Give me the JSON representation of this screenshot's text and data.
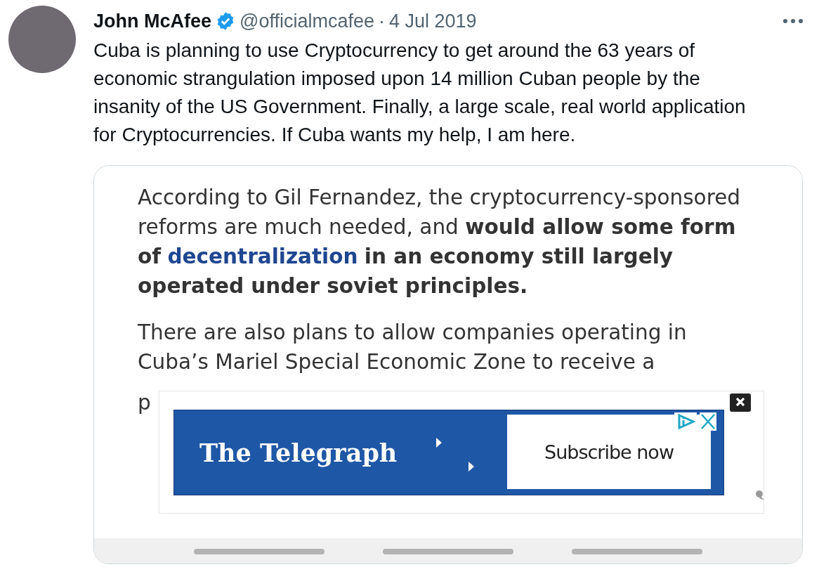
{
  "tweet": {
    "author_name": "John McAfee",
    "verified": true,
    "handle": "@officialmcafee",
    "separator": "·",
    "date": "4 Jul 2019",
    "text": "Cuba is planning to use Cryptocurrency to get around the 63 years of economic strangulation imposed upon 14 million Cuban people by the insanity of the US Government. Finally, a large scale, real world application for Cryptocurrencies. If Cuba wants my help, I am here.",
    "media": {
      "paragraphs": [
        {
          "before": "According to Gil Fernandez, the cryptocurrency-sponsored reforms are much needed, and **would allow some form of**",
          "link": "decentralization",
          "after": "**in an economy still largely operated under soviet principles.**"
        },
        {
          "before": "There are also plans to allow companies operating in Cuba’s Mariel Special Economic Zone to receive a"
        },
        {
          "before": "p"
        }
      ],
      "ad": {
        "brand": "The Telegraph",
        "button": "Subscribe now"
      }
    }
  }
}
